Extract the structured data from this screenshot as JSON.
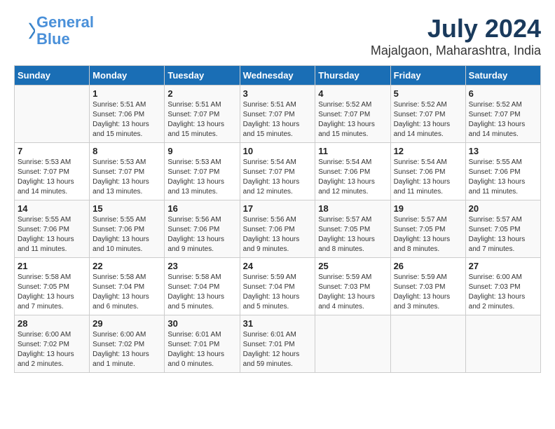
{
  "header": {
    "logo_line1": "General",
    "logo_line2": "Blue",
    "month": "July 2024",
    "location": "Majalgaon, Maharashtra, India"
  },
  "weekdays": [
    "Sunday",
    "Monday",
    "Tuesday",
    "Wednesday",
    "Thursday",
    "Friday",
    "Saturday"
  ],
  "weeks": [
    [
      {
        "day": "",
        "info": ""
      },
      {
        "day": "1",
        "info": "Sunrise: 5:51 AM\nSunset: 7:06 PM\nDaylight: 13 hours\nand 15 minutes."
      },
      {
        "day": "2",
        "info": "Sunrise: 5:51 AM\nSunset: 7:07 PM\nDaylight: 13 hours\nand 15 minutes."
      },
      {
        "day": "3",
        "info": "Sunrise: 5:51 AM\nSunset: 7:07 PM\nDaylight: 13 hours\nand 15 minutes."
      },
      {
        "day": "4",
        "info": "Sunrise: 5:52 AM\nSunset: 7:07 PM\nDaylight: 13 hours\nand 15 minutes."
      },
      {
        "day": "5",
        "info": "Sunrise: 5:52 AM\nSunset: 7:07 PM\nDaylight: 13 hours\nand 14 minutes."
      },
      {
        "day": "6",
        "info": "Sunrise: 5:52 AM\nSunset: 7:07 PM\nDaylight: 13 hours\nand 14 minutes."
      }
    ],
    [
      {
        "day": "7",
        "info": "Sunrise: 5:53 AM\nSunset: 7:07 PM\nDaylight: 13 hours\nand 14 minutes."
      },
      {
        "day": "8",
        "info": "Sunrise: 5:53 AM\nSunset: 7:07 PM\nDaylight: 13 hours\nand 13 minutes."
      },
      {
        "day": "9",
        "info": "Sunrise: 5:53 AM\nSunset: 7:07 PM\nDaylight: 13 hours\nand 13 minutes."
      },
      {
        "day": "10",
        "info": "Sunrise: 5:54 AM\nSunset: 7:07 PM\nDaylight: 13 hours\nand 12 minutes."
      },
      {
        "day": "11",
        "info": "Sunrise: 5:54 AM\nSunset: 7:06 PM\nDaylight: 13 hours\nand 12 minutes."
      },
      {
        "day": "12",
        "info": "Sunrise: 5:54 AM\nSunset: 7:06 PM\nDaylight: 13 hours\nand 11 minutes."
      },
      {
        "day": "13",
        "info": "Sunrise: 5:55 AM\nSunset: 7:06 PM\nDaylight: 13 hours\nand 11 minutes."
      }
    ],
    [
      {
        "day": "14",
        "info": "Sunrise: 5:55 AM\nSunset: 7:06 PM\nDaylight: 13 hours\nand 11 minutes."
      },
      {
        "day": "15",
        "info": "Sunrise: 5:55 AM\nSunset: 7:06 PM\nDaylight: 13 hours\nand 10 minutes."
      },
      {
        "day": "16",
        "info": "Sunrise: 5:56 AM\nSunset: 7:06 PM\nDaylight: 13 hours\nand 9 minutes."
      },
      {
        "day": "17",
        "info": "Sunrise: 5:56 AM\nSunset: 7:06 PM\nDaylight: 13 hours\nand 9 minutes."
      },
      {
        "day": "18",
        "info": "Sunrise: 5:57 AM\nSunset: 7:05 PM\nDaylight: 13 hours\nand 8 minutes."
      },
      {
        "day": "19",
        "info": "Sunrise: 5:57 AM\nSunset: 7:05 PM\nDaylight: 13 hours\nand 8 minutes."
      },
      {
        "day": "20",
        "info": "Sunrise: 5:57 AM\nSunset: 7:05 PM\nDaylight: 13 hours\nand 7 minutes."
      }
    ],
    [
      {
        "day": "21",
        "info": "Sunrise: 5:58 AM\nSunset: 7:05 PM\nDaylight: 13 hours\nand 7 minutes."
      },
      {
        "day": "22",
        "info": "Sunrise: 5:58 AM\nSunset: 7:04 PM\nDaylight: 13 hours\nand 6 minutes."
      },
      {
        "day": "23",
        "info": "Sunrise: 5:58 AM\nSunset: 7:04 PM\nDaylight: 13 hours\nand 5 minutes."
      },
      {
        "day": "24",
        "info": "Sunrise: 5:59 AM\nSunset: 7:04 PM\nDaylight: 13 hours\nand 5 minutes."
      },
      {
        "day": "25",
        "info": "Sunrise: 5:59 AM\nSunset: 7:03 PM\nDaylight: 13 hours\nand 4 minutes."
      },
      {
        "day": "26",
        "info": "Sunrise: 5:59 AM\nSunset: 7:03 PM\nDaylight: 13 hours\nand 3 minutes."
      },
      {
        "day": "27",
        "info": "Sunrise: 6:00 AM\nSunset: 7:03 PM\nDaylight: 13 hours\nand 2 minutes."
      }
    ],
    [
      {
        "day": "28",
        "info": "Sunrise: 6:00 AM\nSunset: 7:02 PM\nDaylight: 13 hours\nand 2 minutes."
      },
      {
        "day": "29",
        "info": "Sunrise: 6:00 AM\nSunset: 7:02 PM\nDaylight: 13 hours\nand 1 minute."
      },
      {
        "day": "30",
        "info": "Sunrise: 6:01 AM\nSunset: 7:01 PM\nDaylight: 13 hours\nand 0 minutes."
      },
      {
        "day": "31",
        "info": "Sunrise: 6:01 AM\nSunset: 7:01 PM\nDaylight: 12 hours\nand 59 minutes."
      },
      {
        "day": "",
        "info": ""
      },
      {
        "day": "",
        "info": ""
      },
      {
        "day": "",
        "info": ""
      }
    ]
  ]
}
